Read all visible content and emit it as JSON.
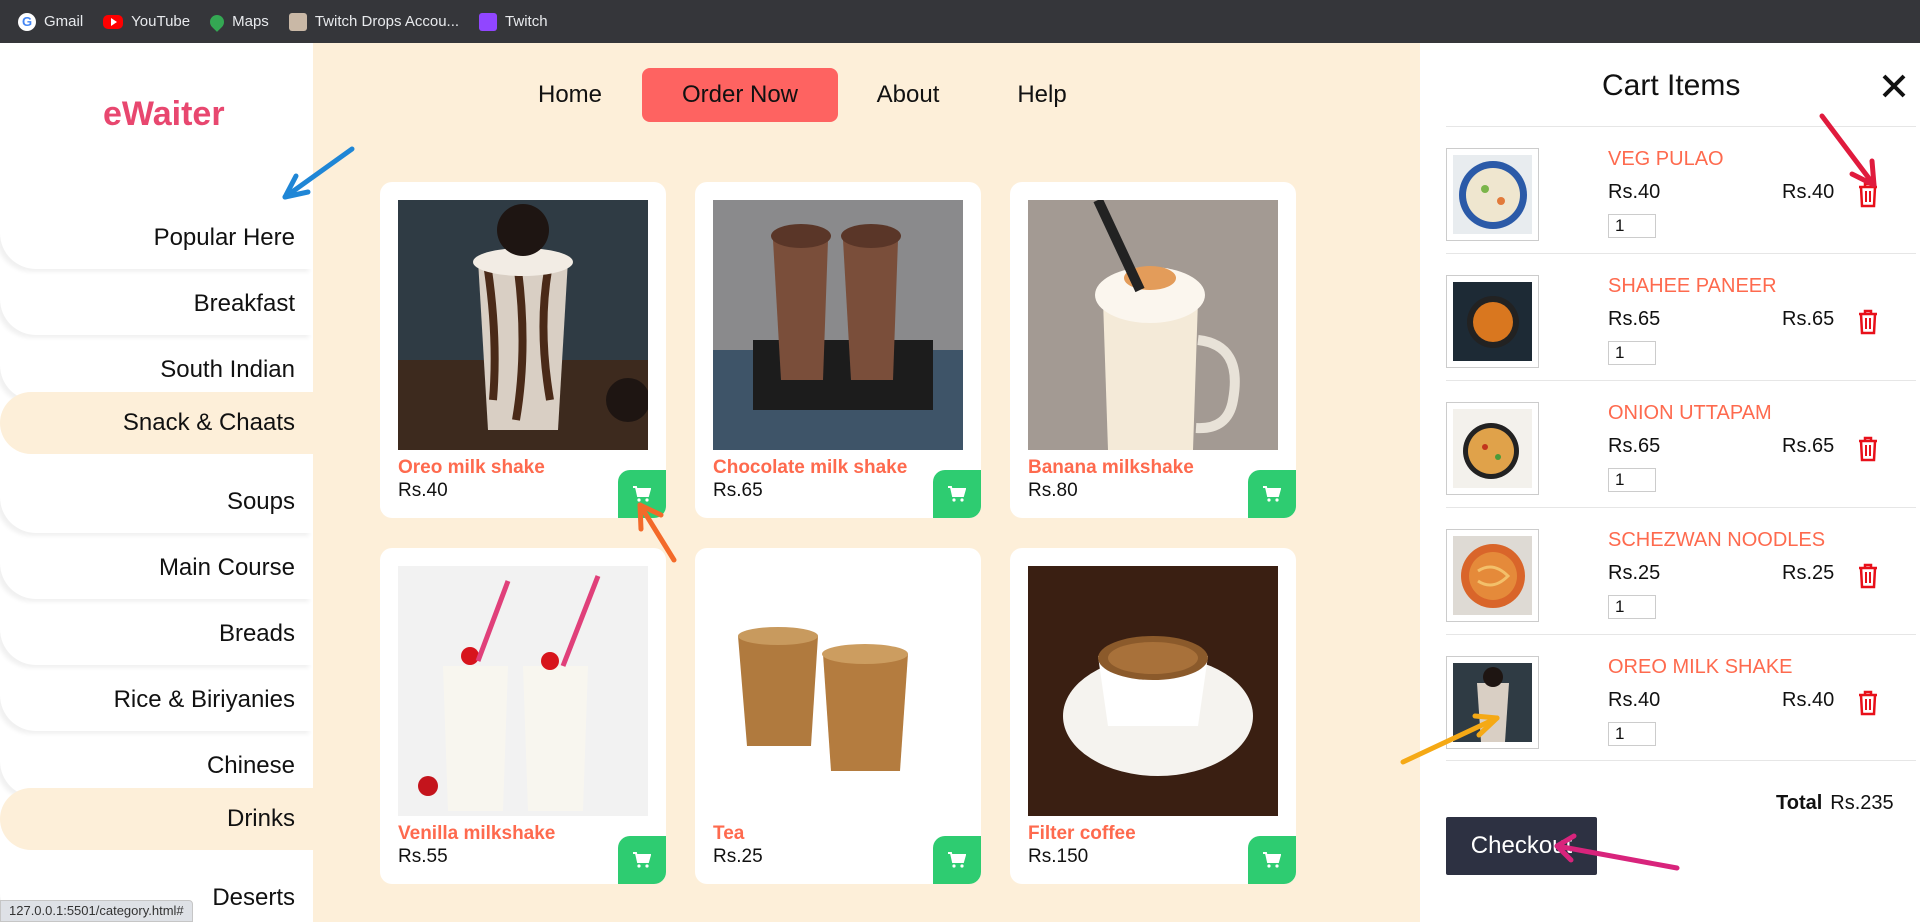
{
  "bookmarks": [
    {
      "label": "Gmail",
      "icon": "gmail-icon"
    },
    {
      "label": "YouTube",
      "icon": "youtube-icon"
    },
    {
      "label": "Maps",
      "icon": "maps-icon"
    },
    {
      "label": "Twitch Drops Accou...",
      "icon": "twitch-drops-icon"
    },
    {
      "label": "Twitch",
      "icon": "twitch-icon"
    }
  ],
  "brand": "eWaiter",
  "nav": [
    {
      "label": "Home"
    },
    {
      "label": "Order Now",
      "active": true
    },
    {
      "label": "About"
    },
    {
      "label": "Help"
    }
  ],
  "categories": [
    {
      "label": "Popular Here"
    },
    {
      "label": "Breakfast"
    },
    {
      "label": "South Indian"
    },
    {
      "label": "Snack & Chaats",
      "active": true
    },
    {
      "label": "Soups"
    },
    {
      "label": "Main Course"
    },
    {
      "label": "Breads"
    },
    {
      "label": "Rice & Biriyanies"
    },
    {
      "label": "Chinese"
    },
    {
      "label": "Drinks",
      "active": true
    },
    {
      "label": "Deserts"
    }
  ],
  "products": [
    {
      "name": "Oreo milk shake",
      "price": "Rs.40"
    },
    {
      "name": "Chocolate milk shake",
      "price": "Rs.65"
    },
    {
      "name": "Banana milkshake",
      "price": "Rs.80"
    },
    {
      "name": "Venilla milkshake",
      "price": "Rs.55"
    },
    {
      "name": "Tea",
      "price": "Rs.25"
    },
    {
      "name": "Filter coffee",
      "price": "Rs.150"
    }
  ],
  "cart": {
    "title": "Cart Items",
    "items": [
      {
        "name": "VEG PULAO",
        "price": "Rs.40",
        "total": "Rs.40",
        "qty": "1"
      },
      {
        "name": "SHAHEE PANEER",
        "price": "Rs.65",
        "total": "Rs.65",
        "qty": "1"
      },
      {
        "name": "ONION UTTAPAM",
        "price": "Rs.65",
        "total": "Rs.65",
        "qty": "1"
      },
      {
        "name": "SCHEZWAN NOODLES",
        "price": "Rs.25",
        "total": "Rs.25",
        "qty": "1"
      },
      {
        "name": "OREO MILK SHAKE",
        "price": "Rs.40",
        "total": "Rs.40",
        "qty": "1"
      }
    ],
    "total_label": "Total",
    "total_value": "Rs.235",
    "checkout_label": "Checkout"
  },
  "status_url": "127.0.0.1:5501/category.html#",
  "colors": {
    "accent": "#fe6361",
    "brand": "#e8476f",
    "add_to_cart": "#2ecc71",
    "page_bg": "#fdefd9",
    "checkout_bg": "#2d3142"
  }
}
